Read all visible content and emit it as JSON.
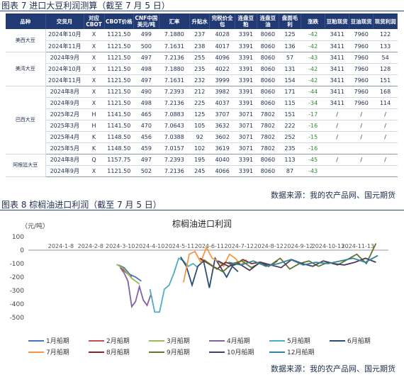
{
  "table_caption": "图表 7 进口大豆利润测算（截至 7 月 5 日）",
  "table_source": "数据来源：我的农产品网、国元期货",
  "chart_caption": "图表 8 棕榈油进口利润（截至 7 月 5 日）",
  "chart_source": "数据来源：我的农产品网、国元期货",
  "headers": [
    "品种",
    "交货月",
    "对应CBOT",
    "CBOT价格",
    "CNF中国美元/吨",
    "汇率",
    "升贴水",
    "完税价全包",
    "连盘豆粕",
    "连盘豆油",
    "盘面毛利",
    "涨跌",
    "豆粕现货",
    "豆油现货",
    "现货利润"
  ],
  "groups": [
    {
      "name": "美西大豆",
      "rows": [
        [
          "2024年10月",
          "X",
          "1121.50",
          "499",
          "7.1880",
          "237",
          "4028",
          "3391",
          "8060",
          "125",
          "-42",
          "3411",
          "7960",
          "122"
        ],
        [
          "2024年11月",
          "X",
          "1121.50",
          "500",
          "7.1631",
          "238",
          "4017",
          "3391",
          "8060",
          "136",
          "-42",
          "3411",
          "7960",
          "133"
        ]
      ]
    },
    {
      "name": "美湾大豆",
      "rows": [
        [
          "2024年9月",
          "X",
          "1121.50",
          "497",
          "7.2136",
          "255",
          "4096",
          "3391",
          "8060",
          "57",
          "-43",
          "3411",
          "7960",
          "54"
        ],
        [
          "2024年10月",
          "X",
          "1121.50",
          "498",
          "7.1880",
          "235",
          "4022",
          "3391",
          "8060",
          "131",
          "-42",
          "3411",
          "7960",
          "128"
        ],
        [
          "2024年11月",
          "X",
          "1121.50",
          "497",
          "7.1631",
          "232",
          "3999",
          "3391",
          "8060",
          "154",
          "-42",
          "3411",
          "7960",
          "151"
        ]
      ]
    },
    {
      "name": "巴西大豆",
      "rows": [
        [
          "2024年8月",
          "X",
          "1121.50",
          "490",
          "7.2393",
          "212",
          "3982",
          "3391",
          "8060",
          "171",
          "-44",
          "3411",
          "7960",
          "168"
        ],
        [
          "2024年9月",
          "X",
          "1121.50",
          "498",
          "7.2136",
          "225",
          "4037",
          "3391",
          "8060",
          "115",
          "-34",
          "3411",
          "7960",
          "114"
        ],
        [
          "2025年2月",
          "H",
          "1141.50",
          "465",
          "7.0883",
          "125",
          "3707",
          "3071",
          "7802",
          "151",
          "-17",
          "/",
          "/",
          "/"
        ],
        [
          "2025年3月",
          "H",
          "1141.50",
          "470",
          "7.0643",
          "105",
          "3632",
          "3071",
          "7802",
          "222",
          "-16",
          "/",
          "/",
          "/"
        ],
        [
          "2025年4月",
          "K",
          "1148.50",
          "456",
          "7.0388",
          "92",
          "3602",
          "3071",
          "7802",
          "252",
          "-15",
          "/",
          "/",
          "/"
        ],
        [
          "2025年5月",
          "K",
          "1148.50",
          "459",
          "7.0157",
          "102",
          "3619",
          "3071",
          "7802",
          "235",
          "-16",
          "",
          "",
          ""
        ]
      ]
    },
    {
      "name": "阿根廷大豆",
      "rows": [
        [
          "2024年8月",
          "Q",
          "1157.75",
          "497",
          "7.2393",
          "195",
          "4040",
          "3391",
          "8060",
          "113",
          "-45",
          "/",
          "/",
          "/"
        ],
        [
          "2024年9月",
          "X",
          "1121.50",
          "502",
          "7.2136",
          "245",
          "4066",
          "3391",
          "8060",
          "87",
          "-43",
          "",
          "",
          ""
        ]
      ]
    }
  ],
  "chart_data": {
    "type": "line",
    "title": "棕榈油进口利润",
    "ylabel": "（元/吨）",
    "ylim": [
      -500,
      100
    ],
    "yticks": [
      100,
      0,
      -100,
      -200,
      -300,
      -400,
      -500
    ],
    "xticks": [
      "2024-1-8",
      "2024-2-8",
      "2024-3-10",
      "2024-4-10",
      "2024-5-11",
      "2024-6-11",
      "2024-7-12",
      "2024-8-12",
      "2024-9-12",
      "2024-10-13",
      "2024-11-13"
    ],
    "xtick_dates": [
      "2024-01-08",
      "2024-02-08",
      "2024-03-10",
      "2024-04-10",
      "2024-05-11",
      "2024-06-11",
      "2024-07-12",
      "2024-08-12",
      "2024-09-12",
      "2024-10-13",
      "2024-11-13"
    ],
    "xrange": [
      "2023-12-05",
      "2024-12-15"
    ],
    "legend": "bottom",
    "series": [
      {
        "name": "1月船期",
        "color": "#4472c4",
        "x": [
          "2024-03-08",
          "2024-03-14",
          "2024-03-20",
          "2024-03-26",
          "2024-04-01"
        ],
        "values": [
          -110,
          -130,
          -180,
          -200,
          -230
        ]
      },
      {
        "name": "2月船期",
        "color": "#c0504d",
        "x": [
          "2024-03-08",
          "2024-03-15",
          "2024-03-22"
        ],
        "values": [
          -110,
          -160,
          -200
        ]
      },
      {
        "name": "3月船期",
        "color": "#9bbb59",
        "x": [
          "2024-03-06",
          "2024-03-14",
          "2024-03-22",
          "2024-03-30"
        ],
        "values": [
          -105,
          -140,
          -210,
          -250
        ]
      },
      {
        "name": "4月船期",
        "color": "#8064a2",
        "x": [
          "2024-03-10",
          "2024-03-14",
          "2024-03-18",
          "2024-03-22",
          "2024-03-26",
          "2024-03-30",
          "2024-04-03",
          "2024-04-07",
          "2024-04-11"
        ],
        "values": [
          -130,
          -170,
          -230,
          -420,
          -380,
          -270,
          -370,
          -410,
          -330
        ]
      },
      {
        "name": "5月船期",
        "color": "#4bacc6",
        "x": [
          "2024-04-10",
          "2024-04-15",
          "2024-04-20",
          "2024-04-25",
          "2024-04-30",
          "2024-05-05",
          "2024-05-10",
          "2024-05-15",
          "2024-05-20",
          "2024-05-25",
          "2024-05-30"
        ],
        "values": [
          -290,
          -460,
          -460,
          -290,
          -260,
          -170,
          -60,
          -80,
          -120,
          -100,
          -130
        ]
      },
      {
        "name": "6月船期",
        "color": "#2c4d75",
        "x": [
          "2024-05-12",
          "2024-05-18",
          "2024-05-24",
          "2024-05-30",
          "2024-06-05",
          "2024-06-11",
          "2024-06-17",
          "2024-06-23",
          "2024-06-29",
          "2024-07-05",
          "2024-07-11"
        ],
        "values": [
          -50,
          -120,
          -260,
          -120,
          -80,
          -280,
          -60,
          -130,
          -200,
          -120,
          -160
        ]
      },
      {
        "name": "7月船期",
        "color": "#f79646",
        "x": [
          "2024-05-15",
          "2024-05-21",
          "2024-05-27",
          "2024-06-02",
          "2024-06-08",
          "2024-06-14",
          "2024-06-20",
          "2024-06-26",
          "2024-07-02",
          "2024-07-08",
          "2024-07-14",
          "2024-07-20"
        ],
        "values": [
          -240,
          -30,
          -10,
          -90,
          20,
          -60,
          -80,
          -120,
          -30,
          -60,
          -110,
          -70
        ]
      },
      {
        "name": "8月船期",
        "color": "#772c2a",
        "x": [
          "2024-06-01",
          "2024-06-10",
          "2024-06-19",
          "2024-06-28",
          "2024-07-07",
          "2024-07-16",
          "2024-07-25",
          "2024-08-03",
          "2024-08-12",
          "2024-08-21"
        ],
        "values": [
          -60,
          -100,
          -140,
          -90,
          -110,
          -70,
          -100,
          -90,
          -120,
          -80
        ]
      },
      {
        "name": "9月船期",
        "color": "#5f7530",
        "x": [
          "2024-06-05",
          "2024-06-15",
          "2024-06-25",
          "2024-07-05",
          "2024-07-15",
          "2024-07-25",
          "2024-08-04",
          "2024-08-14",
          "2024-08-24",
          "2024-09-03",
          "2024-09-13",
          "2024-09-23",
          "2024-10-03",
          "2024-10-13",
          "2024-10-23",
          "2024-11-02",
          "2024-11-12",
          "2024-11-22",
          "2024-12-02"
        ],
        "values": [
          -70,
          -120,
          -160,
          -100,
          -80,
          -130,
          -90,
          -110,
          -60,
          -140,
          -100,
          -80,
          -120,
          -90,
          -110,
          -70,
          -30,
          -100,
          50
        ]
      },
      {
        "name": "10月船期",
        "color": "#4d3b62",
        "x": [
          "2024-06-20",
          "2024-07-01",
          "2024-07-12",
          "2024-07-23",
          "2024-08-03",
          "2024-08-14",
          "2024-08-25",
          "2024-09-05",
          "2024-09-16",
          "2024-09-27",
          "2024-10-08",
          "2024-10-19",
          "2024-10-30",
          "2024-11-10",
          "2024-11-21",
          "2024-12-02"
        ],
        "values": [
          -80,
          -120,
          -100,
          -150,
          -90,
          -110,
          -130,
          -70,
          -100,
          -120,
          -80,
          -100,
          -110,
          -90,
          -60,
          -90
        ]
      },
      {
        "name": "12月船期",
        "color": "#31849b",
        "x": [
          "2024-07-01",
          "2024-07-14",
          "2024-07-27",
          "2024-08-09",
          "2024-08-22",
          "2024-09-04",
          "2024-09-17",
          "2024-09-30",
          "2024-10-13",
          "2024-10-26",
          "2024-11-08",
          "2024-11-21",
          "2024-12-04"
        ],
        "values": [
          -90,
          -110,
          -80,
          -120,
          -100,
          -70,
          -110,
          -90,
          -100,
          -80,
          -60,
          -90,
          -40
        ]
      }
    ]
  }
}
